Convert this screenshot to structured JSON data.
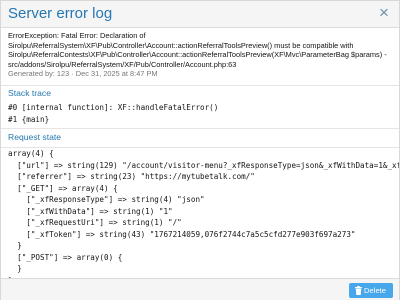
{
  "dialog": {
    "title": "Server error log",
    "close_glyph": "×"
  },
  "error": {
    "lines": [
      "ErrorException: Fatal Error: Declaration of",
      "Sirolpu\\ReferralSystem\\XF\\Pub\\Controller\\Account::actionReferralToolsPreview() must be compatible with",
      "Sirolpu\\ReferralContests\\XF\\Pub\\Controller\\Account::actionReferralToolsPreview(XF\\Mvc\\ParameterBag $params) -",
      "src/addons/Sirolpu/ReferralSystem/XF/Pub/Controller/Account.php:63"
    ],
    "meta": "Generated by: 123 · Dec 31, 2025 at 8:47 PM"
  },
  "stack_trace": {
    "title": "Stack trace",
    "lines": [
      "#0 [internal function]: XF::handleFatalError()",
      "#1 {main}"
    ]
  },
  "request_state": {
    "title": "Request state",
    "lines": [
      "array(4) {",
      "  [\"url\"] => string(129) \"/account/visitor-menu?_xfResponseType=json&_xfWithData=1&_xfRe",
      "  [\"referrer\"] => string(23) \"https://mytubetalk.com/\"",
      "  [\"_GET\"] => array(4) {",
      "    [\"_xfResponseType\"] => string(4) \"json\"",
      "    [\"_xfWithData\"] => string(1) \"1\"",
      "    [\"_xfRequestUri\"] => string(1) \"/\"",
      "    [\"_xfToken\"] => string(43) \"1767214059,076f2744c7a5c5cfd277e903f697a273\"",
      "  }",
      "  [\"_POST\"] => array(0) {",
      "  }",
      "}"
    ]
  },
  "footer": {
    "delete_label": "Delete",
    "delete_icon": "trash-icon"
  },
  "colors": {
    "accent": "#2577b1",
    "button": "#47a7eb"
  }
}
